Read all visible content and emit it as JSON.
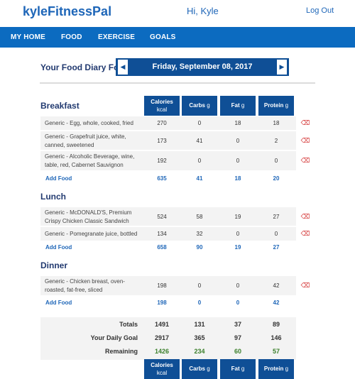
{
  "app": {
    "brand": "kyleFitnessPal",
    "greeting": "Hi, Kyle",
    "logout": "Log Out"
  },
  "nav": [
    "MY HOME",
    "FOOD",
    "EXERCISE",
    "GOALS"
  ],
  "diary": {
    "label": "Your Food Diary For:",
    "date": "Friday, September 08, 2017"
  },
  "columns": [
    {
      "name": "Calories",
      "unit": "kcal"
    },
    {
      "name": "Carbs",
      "unit": "g"
    },
    {
      "name": "Fat",
      "unit": "g"
    },
    {
      "name": "Protein",
      "unit": "g"
    }
  ],
  "add_food_label": "Add Food",
  "meals": [
    {
      "title": "Breakfast",
      "foods": [
        {
          "name": "Generic - Egg, whole, cooked, fried",
          "values": [
            "270",
            "0",
            "18",
            "18"
          ]
        },
        {
          "name": "Generic - Grapefruit juice, white, canned, sweetened",
          "values": [
            "173",
            "41",
            "0",
            "2"
          ]
        },
        {
          "name": "Generic - Alcoholic Beverage, wine, table, red, Cabernet Sauvignon",
          "values": [
            "192",
            "0",
            "0",
            "0"
          ]
        }
      ],
      "subtotal": [
        "635",
        "41",
        "18",
        "20"
      ]
    },
    {
      "title": "Lunch",
      "foods": [
        {
          "name": "Generic - McDONALD'S, Premium Crispy Chicken Classic Sandwich",
          "values": [
            "524",
            "58",
            "19",
            "27"
          ]
        },
        {
          "name": "Generic - Pomegranate juice, bottled",
          "values": [
            "134",
            "32",
            "0",
            "0"
          ]
        }
      ],
      "subtotal": [
        "658",
        "90",
        "19",
        "27"
      ]
    },
    {
      "title": "Dinner",
      "foods": [
        {
          "name": "Generic - Chicken breast, oven-roasted, fat-free, sliced",
          "values": [
            "198",
            "0",
            "0",
            "42"
          ]
        }
      ],
      "subtotal": [
        "198",
        "0",
        "0",
        "42"
      ]
    }
  ],
  "totals": {
    "totals_label": "Totals",
    "totals": [
      "1491",
      "131",
      "37",
      "89"
    ],
    "goal_label": "Your Daily Goal",
    "goal": [
      "2917",
      "365",
      "97",
      "146"
    ],
    "remaining_label": "Remaining",
    "remaining": [
      "1426",
      "234",
      "60",
      "57"
    ]
  },
  "icons": {
    "prev": "arrow-left-icon",
    "next": "arrow-right-icon",
    "delete": "delete-icon"
  },
  "colors": {
    "brand": "#1e66b8",
    "nav": "#0c6bc0",
    "header": "#0f4f96",
    "remaining": "#3a7f2a",
    "delete": "#d53a3a"
  }
}
